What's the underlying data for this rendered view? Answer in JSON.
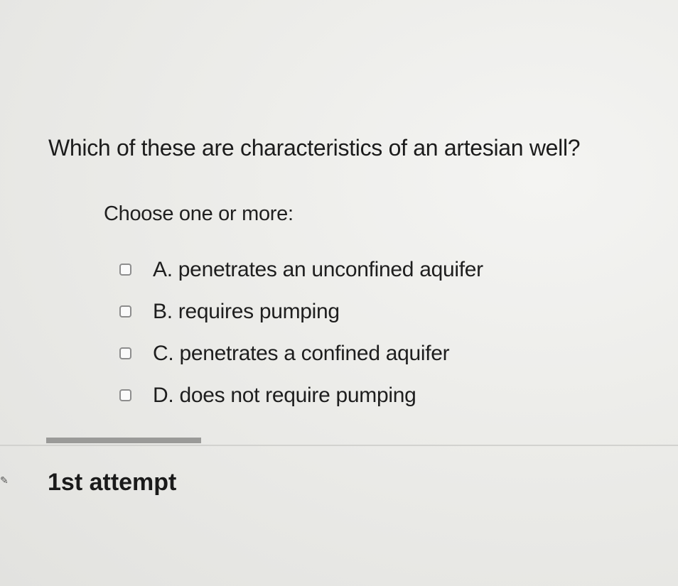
{
  "question": {
    "text": "Which of these are characteristics of an artesian well?"
  },
  "instruction": "Choose one or more:",
  "options": [
    {
      "letter": "A.",
      "text": "penetrates an unconfined aquifer",
      "checked": false
    },
    {
      "letter": "B.",
      "text": "requires pumping",
      "checked": false
    },
    {
      "letter": "C.",
      "text": "penetrates a confined aquifer",
      "checked": false
    },
    {
      "letter": "D.",
      "text": "does not require pumping",
      "checked": false
    }
  ],
  "attempt": "1st attempt"
}
